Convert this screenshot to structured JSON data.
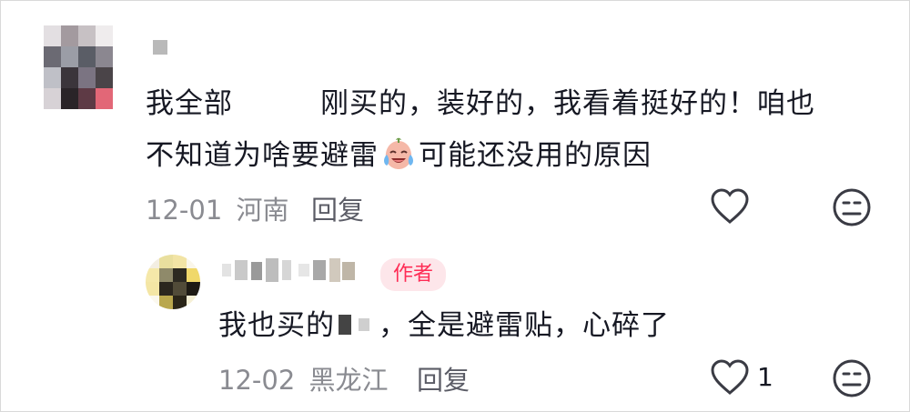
{
  "comment": {
    "author_name": "",
    "text_part1": "我全部",
    "text_part2": "刚买的，装好的，我看着挺好的！咱也",
    "text_line2_a": "不知道为啥要避雷",
    "text_line2_b": "可能还没用的原因",
    "emoji": "crying-laughing-emoji",
    "date": "12-01",
    "location": "河南",
    "reply_label": "回复"
  },
  "reply": {
    "author_name": "",
    "author_badge": "作者",
    "text_a": "我也买的",
    "text_b": "，全是避雷贴，心碎了",
    "date": "12-02",
    "location": "黑龙江",
    "reply_label": "回复",
    "like_count": "1"
  },
  "colors": {
    "accent": "#fe2c55",
    "badge_bg": "#fde6ea",
    "meta": "#8a8b91"
  }
}
